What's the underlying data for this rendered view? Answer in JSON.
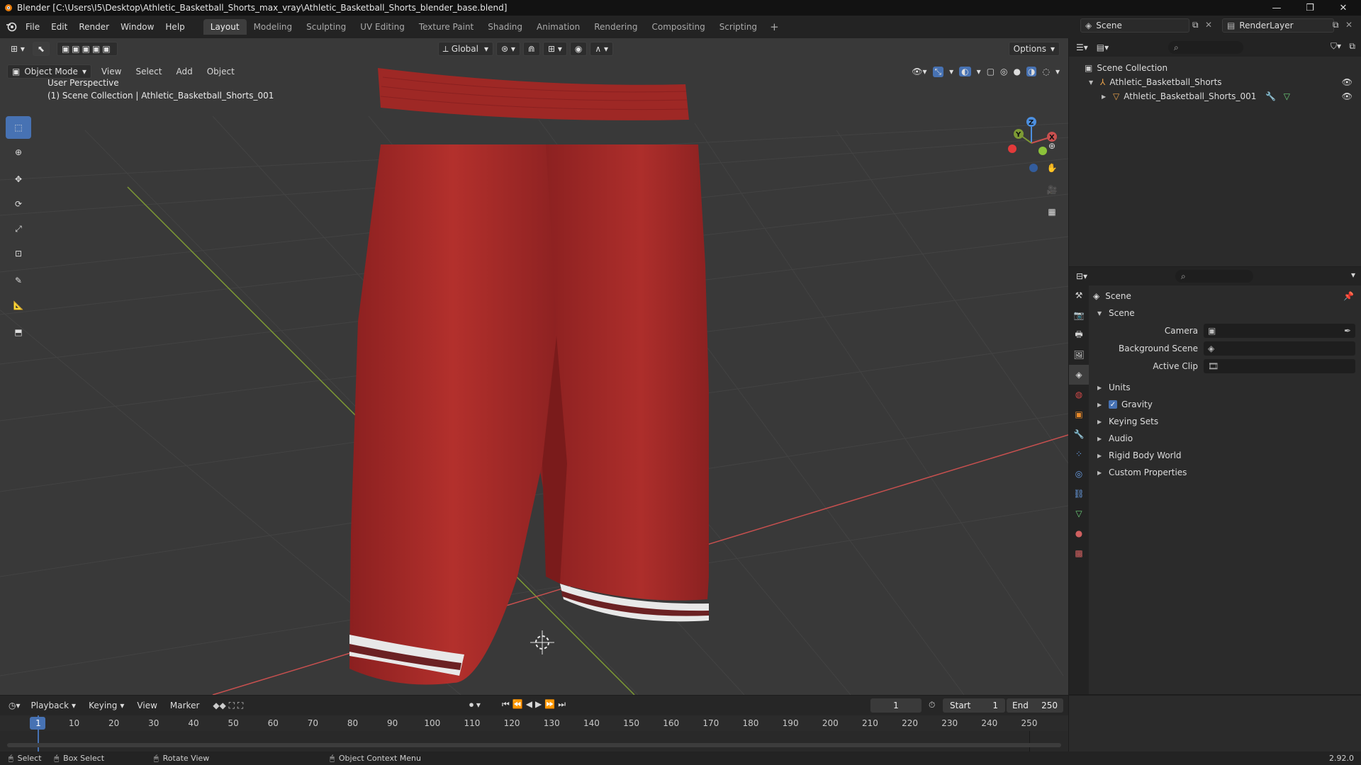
{
  "window": {
    "title": "Blender [C:\\Users\\I5\\Desktop\\Athletic_Basketball_Shorts_max_vray\\Athletic_Basketball_Shorts_blender_base.blend]"
  },
  "menu": [
    "File",
    "Edit",
    "Render",
    "Window",
    "Help"
  ],
  "workspaces": [
    "Layout",
    "Modeling",
    "Sculpting",
    "UV Editing",
    "Texture Paint",
    "Shading",
    "Animation",
    "Rendering",
    "Compositing",
    "Scripting"
  ],
  "active_workspace": "Layout",
  "scene_selector": {
    "value": "Scene"
  },
  "renderlayer_selector": {
    "value": "RenderLayer"
  },
  "viewport": {
    "transform_orientation": "Global",
    "options_label": "Options",
    "mode": "Object Mode",
    "header_menus": [
      "View",
      "Select",
      "Add",
      "Object"
    ],
    "overlay_line1": "User Perspective",
    "overlay_line2": "(1) Scene Collection | Athletic_Basketball_Shorts_001",
    "gizmo_axes": {
      "x": "X",
      "y": "Y",
      "z": "Z"
    }
  },
  "outliner": {
    "root": "Scene Collection",
    "items": [
      {
        "label": "Athletic_Basketball_Shorts"
      },
      {
        "label": "Athletic_Basketball_Shorts_001"
      }
    ]
  },
  "properties": {
    "context": "Scene",
    "section": "Scene",
    "fields": [
      {
        "label": "Camera",
        "value": ""
      },
      {
        "label": "Background Scene",
        "value": ""
      },
      {
        "label": "Active Clip",
        "value": ""
      }
    ],
    "panels": [
      {
        "label": "Units",
        "checkbox": false
      },
      {
        "label": "Gravity",
        "checkbox": true
      },
      {
        "label": "Keying Sets",
        "checkbox": false
      },
      {
        "label": "Audio",
        "checkbox": false
      },
      {
        "label": "Rigid Body World",
        "checkbox": false
      },
      {
        "label": "Custom Properties",
        "checkbox": false
      }
    ]
  },
  "timeline": {
    "menus": [
      "Playback",
      "Keying",
      "View",
      "Marker"
    ],
    "current_frame": "1",
    "start_label": "Start",
    "start_value": "1",
    "end_label": "End",
    "end_value": "250",
    "ticks": [
      "1",
      "10",
      "20",
      "30",
      "40",
      "50",
      "60",
      "70",
      "80",
      "90",
      "100",
      "110",
      "120",
      "130",
      "140",
      "150",
      "160",
      "170",
      "180",
      "190",
      "200",
      "210",
      "220",
      "230",
      "240",
      "250"
    ]
  },
  "statusbar": {
    "select": "Select",
    "box_select": "Box Select",
    "rotate_view": "Rotate View",
    "context_menu": "Object Context Menu",
    "version": "2.92.0"
  },
  "colors": {
    "accent": "#4772b3",
    "shorts_red": "#a82a28",
    "stripe_maroon": "#6b2123",
    "axis_x": "#c8504f",
    "axis_y": "#7d9a34"
  }
}
